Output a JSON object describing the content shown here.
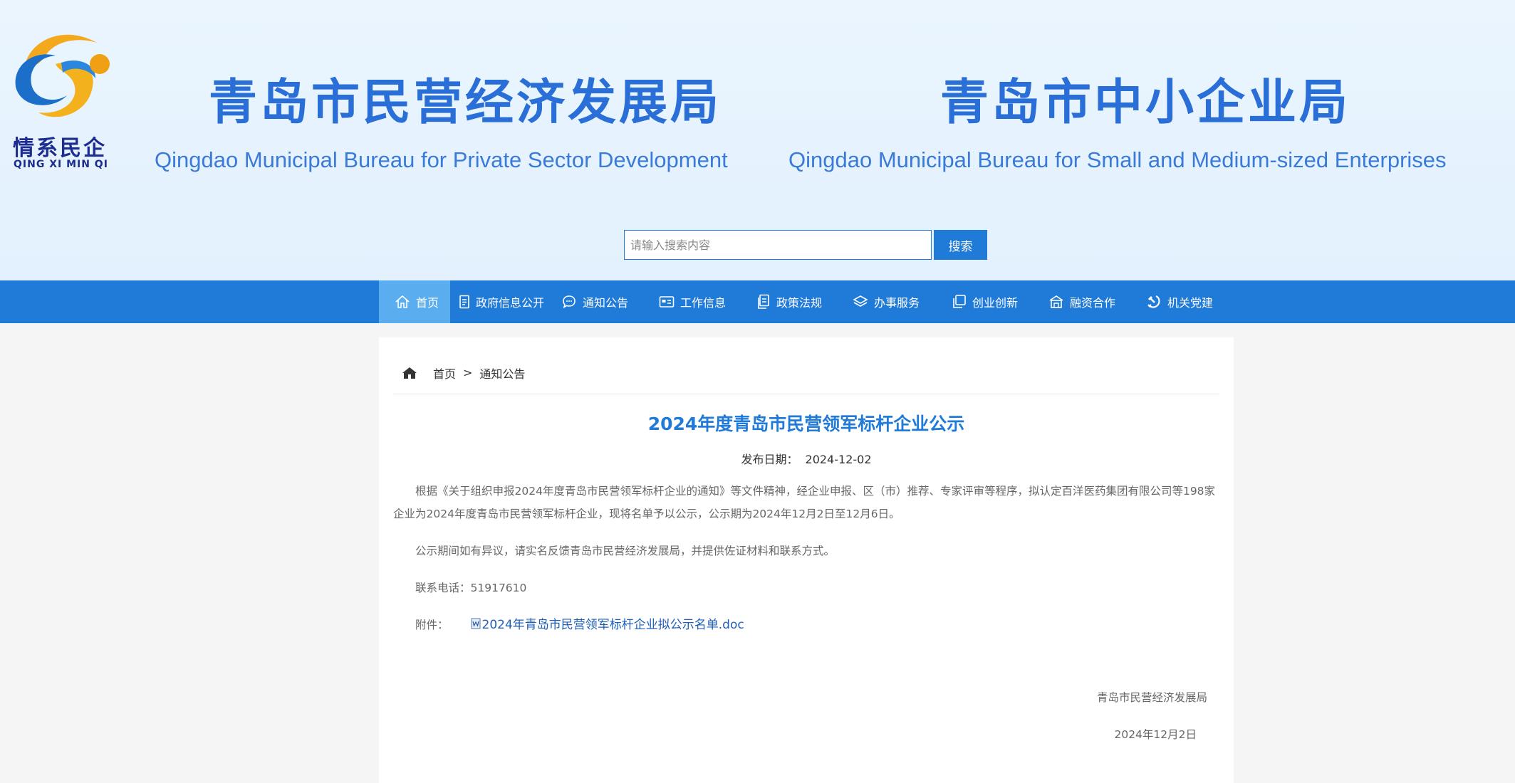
{
  "header": {
    "logo": {
      "cn": "情系民企",
      "en": "QING XI MIN QI"
    },
    "left_title_cn": "青岛市民营经济发展局",
    "left_title_en": "Qingdao Municipal Bureau for Private Sector Development",
    "right_title_cn": "青岛市中小企业局",
    "right_title_en": "Qingdao Municipal Bureau for Small and Medium-sized Enterprises"
  },
  "search": {
    "placeholder": "请输入搜索内容",
    "button": "搜索"
  },
  "nav": {
    "items": [
      {
        "label": "首页",
        "icon": "home-icon",
        "active": true
      },
      {
        "label": "政府信息公开",
        "icon": "document-icon"
      },
      {
        "label": "通知公告",
        "icon": "chat-bubble-icon"
      },
      {
        "label": "工作信息",
        "icon": "id-card-icon"
      },
      {
        "label": "政策法规",
        "icon": "file-copy-icon"
      },
      {
        "label": "办事服务",
        "icon": "layers-icon"
      },
      {
        "label": "创业创新",
        "icon": "copy-icon"
      },
      {
        "label": "融资合作",
        "icon": "building-icon"
      },
      {
        "label": "机关党建",
        "icon": "party-emblem-icon"
      }
    ]
  },
  "breadcrumb": {
    "home": "首页",
    "separator": ">",
    "current": "通知公告"
  },
  "article": {
    "title": "2024年度青岛市民营领军标杆企业公示",
    "date_label": "发布日期：",
    "date": "2024-12-02",
    "paragraphs": [
      "根据《关于组织申报2024年度青岛市民营领军标杆企业的通知》等文件精神，经企业申报、区（市）推荐、专家评审等程序，拟认定百洋医药集团有限公司等198家企业为2024年度青岛市民营领军标杆企业，现将名单予以公示，公示期为2024年12月2日至12月6日。",
      "公示期间如有异议，请实名反馈青岛市民营经济发展局，并提供佐证材料和联系方式。",
      "联系电话：51917610"
    ],
    "attachment_label": "附件：",
    "attachment_name": "2024年青岛市民营领军标杆企业拟公示名单.doc",
    "signature_org": "青岛市民营经济发展局",
    "signature_date": "2024年12月2日"
  },
  "colors": {
    "primary": "#1f7ad8",
    "nav_active": "#5aaef0",
    "header_bg": "#e6f3fe"
  }
}
